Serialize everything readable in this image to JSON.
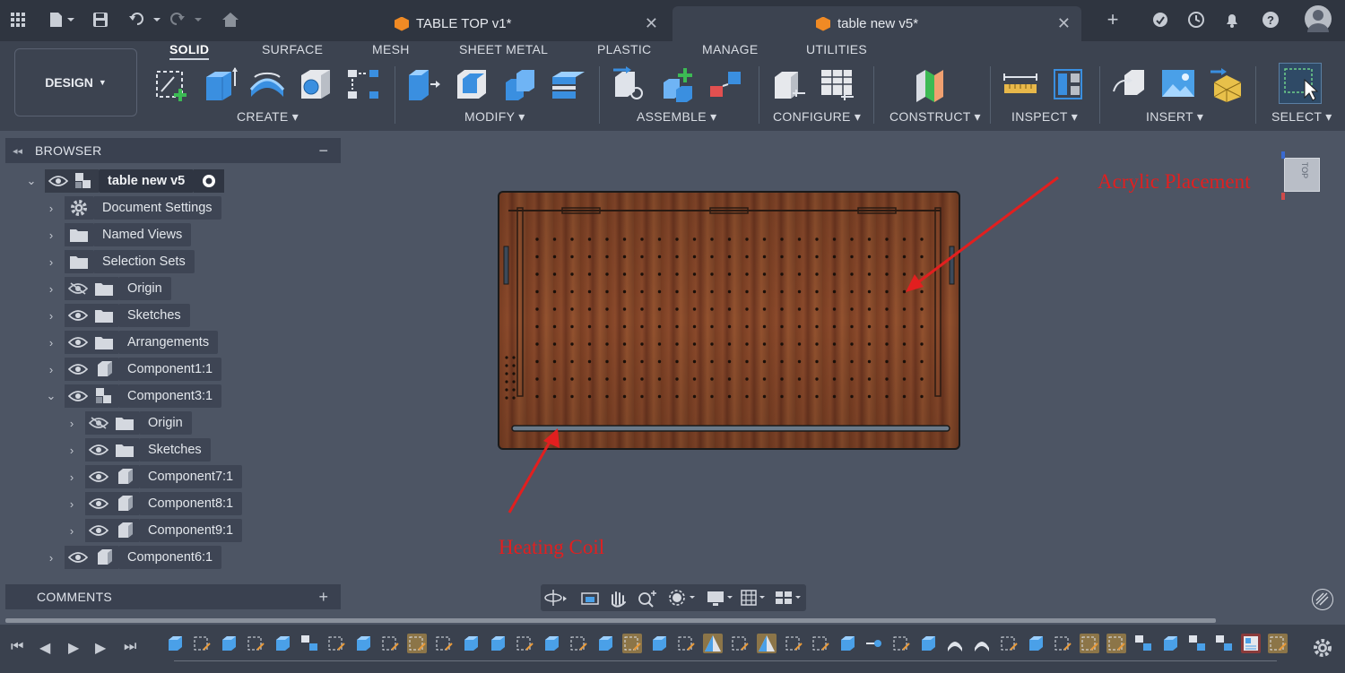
{
  "tabs": [
    {
      "title": "TABLE TOP v1*",
      "active": false
    },
    {
      "title": "table new v5*",
      "active": true
    }
  ],
  "workspace": {
    "design_label": "DESIGN",
    "tabs": [
      "SOLID",
      "SURFACE",
      "MESH",
      "SHEET METAL",
      "PLASTIC",
      "MANAGE",
      "UTILITIES"
    ],
    "active_tab": "SOLID",
    "groups": [
      "CREATE",
      "MODIFY",
      "ASSEMBLE",
      "CONFIGURE",
      "CONSTRUCT",
      "INSPECT",
      "INSERT",
      "SELECT"
    ]
  },
  "browser": {
    "title": "BROWSER",
    "root": "table new v5",
    "items": [
      {
        "label": "Document Settings",
        "icon": "gear-icon",
        "level": 1
      },
      {
        "label": "Named Views",
        "icon": "folder-icon",
        "level": 1
      },
      {
        "label": "Selection Sets",
        "icon": "folder-icon",
        "level": 1
      },
      {
        "label": "Origin",
        "icon": "folder-icon",
        "level": 1,
        "eye": "hidden"
      },
      {
        "label": "Sketches",
        "icon": "folder-icon",
        "level": 1,
        "eye": "visible"
      },
      {
        "label": "Arrangements",
        "icon": "folder-icon",
        "level": 1,
        "eye": "visible"
      },
      {
        "label": "Component1:1",
        "icon": "component-icon",
        "level": 1,
        "eye": "visible"
      },
      {
        "label": "Component3:1",
        "icon": "assembly-icon",
        "level": 1,
        "eye": "visible",
        "expanded": true
      },
      {
        "label": "Origin",
        "icon": "folder-icon",
        "level": 2,
        "eye": "hidden"
      },
      {
        "label": "Sketches",
        "icon": "folder-icon",
        "level": 2,
        "eye": "visible"
      },
      {
        "label": "Component7:1",
        "icon": "component-icon",
        "level": 2,
        "eye": "visible"
      },
      {
        "label": "Component8:1",
        "icon": "component-icon",
        "level": 2,
        "eye": "visible"
      },
      {
        "label": "Component9:1",
        "icon": "component-icon",
        "level": 2,
        "eye": "visible"
      },
      {
        "label": "Component6:1",
        "icon": "component-icon",
        "level": 1,
        "eye": "visible"
      }
    ]
  },
  "comments": {
    "title": "COMMENTS"
  },
  "canvas": {
    "annotations": [
      "Acrylic Placement",
      "Heating Coil"
    ],
    "viewcube_label": "TOP"
  }
}
